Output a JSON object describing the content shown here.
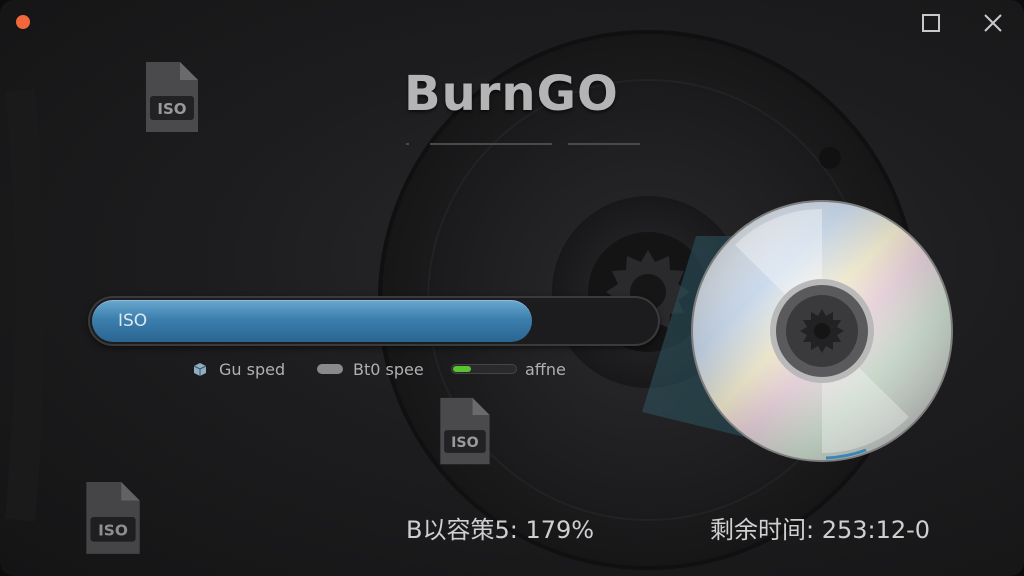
{
  "app": {
    "title": "BurnGO"
  },
  "file_icons": {
    "label": "ISO"
  },
  "progress": {
    "label": "ISO",
    "fraction": 0.78
  },
  "legend": {
    "item1": "Gu sped",
    "item2": "Bt0 spee",
    "item3": "affne"
  },
  "status": {
    "speed_text": "B以容策5:  179%",
    "remaining_text": "剩余时间: 253:12-0"
  },
  "colors": {
    "close_dot": "#f2673b",
    "progress_blue": "#3c7fae",
    "indicator_green": "#58c431"
  },
  "icons": {
    "window_close": "close-icon",
    "window_maximize": "maximize-icon",
    "file": "iso-file-icon",
    "disc": "disc-icon"
  }
}
